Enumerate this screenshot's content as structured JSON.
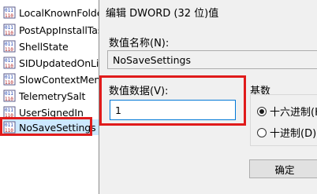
{
  "value_list": {
    "items": [
      {
        "label": "LocalKnownFolde",
        "selected": false
      },
      {
        "label": "PostAppInstallTas",
        "selected": false
      },
      {
        "label": "ShellState",
        "selected": false
      },
      {
        "label": "SIDUpdatedOnLib",
        "selected": false
      },
      {
        "label": "SlowContextMenu",
        "selected": false
      },
      {
        "label": "TelemetrySalt",
        "selected": false
      },
      {
        "label": "UserSignedIn",
        "selected": false
      },
      {
        "label": "NoSaveSettings",
        "selected": true
      }
    ],
    "icon": "registry-binary-value-icon",
    "highlight_color": "#e01b1b"
  },
  "dialog": {
    "title": "编辑 DWORD (32 位)值",
    "value_name_label": "数值名称(N):",
    "value_name": "NoSaveSettings",
    "value_data_label": "数值数据(V):",
    "value_data": "1",
    "base_label": "基数",
    "radio_hex": "十六进制(H",
    "radio_dec": "十进制(D)",
    "selected_base": "hex",
    "ok_label": "确定"
  }
}
